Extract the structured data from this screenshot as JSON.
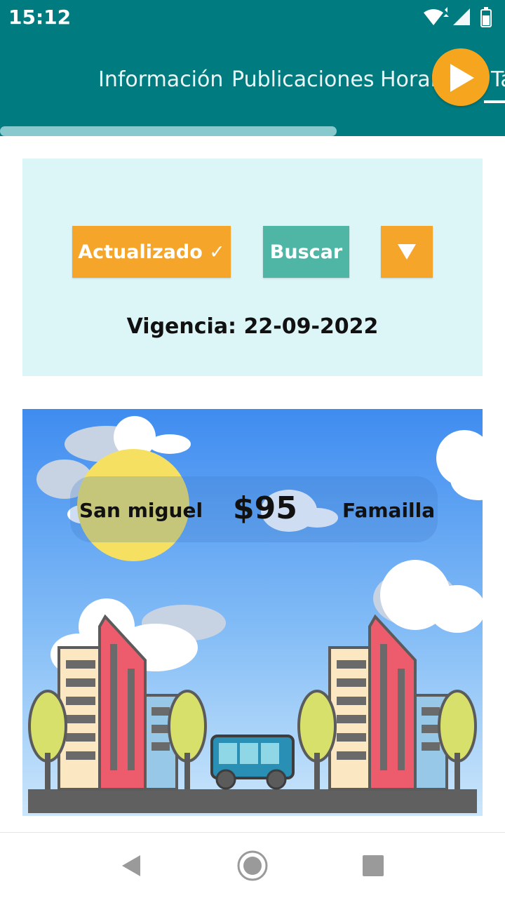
{
  "status_bar": {
    "time": "15:12"
  },
  "tabs": [
    {
      "label": "Información"
    },
    {
      "label": "Publicaciones"
    },
    {
      "label": "Horarios"
    },
    {
      "label": "Tarifas"
    }
  ],
  "info_card": {
    "updated_label": "Actualizado ✓",
    "search_label": "Buscar",
    "validity": "Vigencia: 22-09-2022"
  },
  "route": {
    "origin": "San miguel",
    "price": "$95",
    "destination": "Famailla"
  },
  "colors": {
    "primary": "#007c80",
    "accent": "#f6a52b",
    "search_button": "#4fb6a6",
    "card_background": "#dcf5f7"
  },
  "icons": [
    "wifi-icon",
    "signal-icon",
    "battery-icon",
    "play-icon",
    "dropdown-triangle-icon",
    "back-icon",
    "home-icon",
    "recents-icon"
  ]
}
